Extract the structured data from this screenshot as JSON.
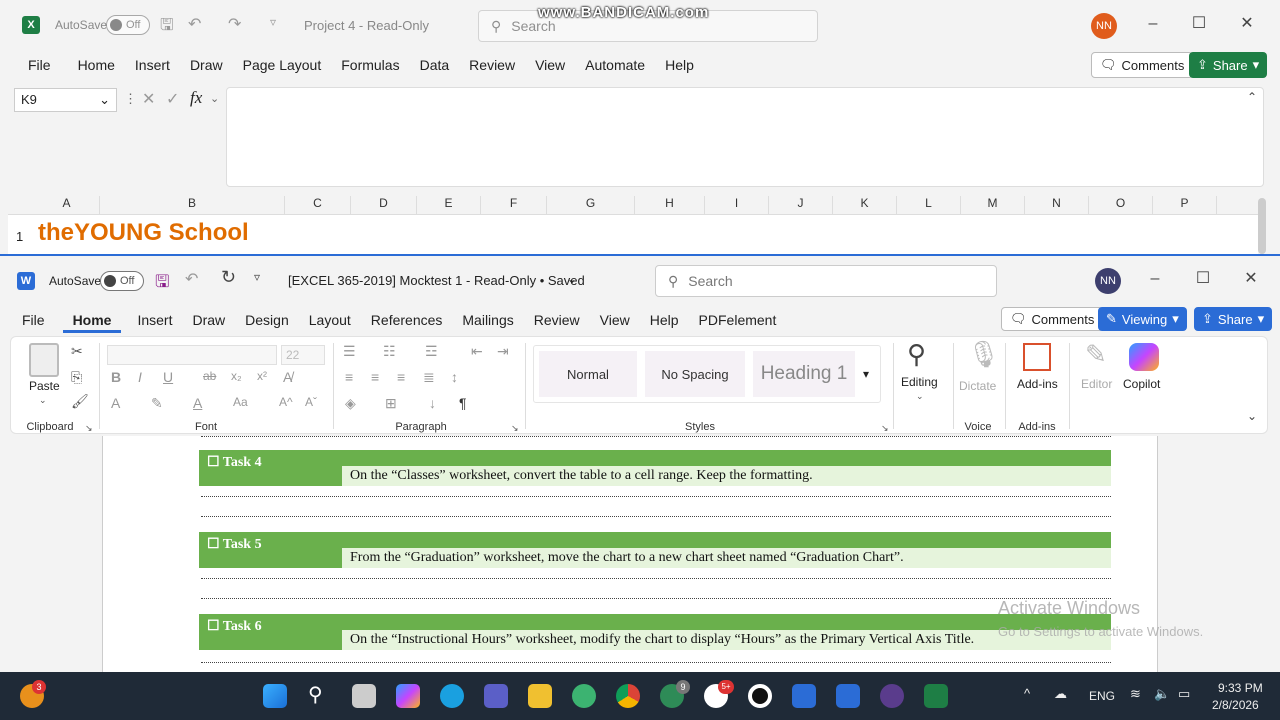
{
  "excel": {
    "autosave_label": "AutoSave",
    "autosave_state": "Off",
    "title": "Project 4  -  Read-Only",
    "search_placeholder": "Search",
    "avatar": "NN",
    "menu": [
      "File",
      "Home",
      "Insert",
      "Draw",
      "Page Layout",
      "Formulas",
      "Data",
      "Review",
      "View",
      "Automate",
      "Help"
    ],
    "comments_label": "Comments",
    "share_label": "Share",
    "name_box": "K9",
    "fx": "fx",
    "columns": [
      "A",
      "B",
      "C",
      "D",
      "E",
      "F",
      "G",
      "H",
      "I",
      "J",
      "K",
      "L",
      "M",
      "N",
      "O",
      "P"
    ],
    "row_number": "1",
    "cell_a1": "theYOUNG School",
    "brand_color": "#e06c00"
  },
  "watermark_top": "www.BANDICAM.com",
  "word": {
    "autosave_label": "AutoSave",
    "autosave_state": "Off",
    "title": "[EXCEL 365-2019] Mocktest 1  -  Read-Only • Saved",
    "search_placeholder": "Search",
    "avatar": "NN",
    "menu": [
      "File",
      "Home",
      "Insert",
      "Draw",
      "Design",
      "Layout",
      "References",
      "Mailings",
      "Review",
      "View",
      "Help",
      "PDFelement"
    ],
    "comments_label": "Comments",
    "viewing_label": "Viewing",
    "share_label": "Share",
    "ribbon": {
      "paste": "Paste",
      "clipboard": "Clipboard",
      "font_size": "22",
      "font": "Font",
      "paragraph": "Paragraph",
      "styles_label": "Styles",
      "style_normal": "Normal",
      "style_nospacing": "No Spacing",
      "style_heading1": "Heading 1",
      "editing": "Editing",
      "dictate": "Dictate",
      "voice": "Voice",
      "addins": "Add-ins",
      "addins_group": "Add-ins",
      "editor": "Editor",
      "copilot": "Copilot"
    },
    "tasks": [
      {
        "label": "☐ Task 4",
        "text": "On the “Classes” worksheet, convert the table to a cell range. Keep the formatting."
      },
      {
        "label": "☐ Task 5",
        "text": "From the “Graduation” worksheet, move the chart to a new chart sheet named “Graduation Chart”."
      },
      {
        "label": "☐ Task 6",
        "text": "On the “Instructional Hours” worksheet, modify the chart to display “Hours” as the Primary Vertical Axis Title."
      }
    ]
  },
  "activate": {
    "line1": "Activate Windows",
    "line2": "Go to Settings to activate Windows."
  },
  "taskbar": {
    "weather_badge": "3",
    "lang": "ENG",
    "time": "9:33 PM",
    "date": "2/8/2026",
    "badge_a": "9",
    "badge_b": "5+"
  }
}
